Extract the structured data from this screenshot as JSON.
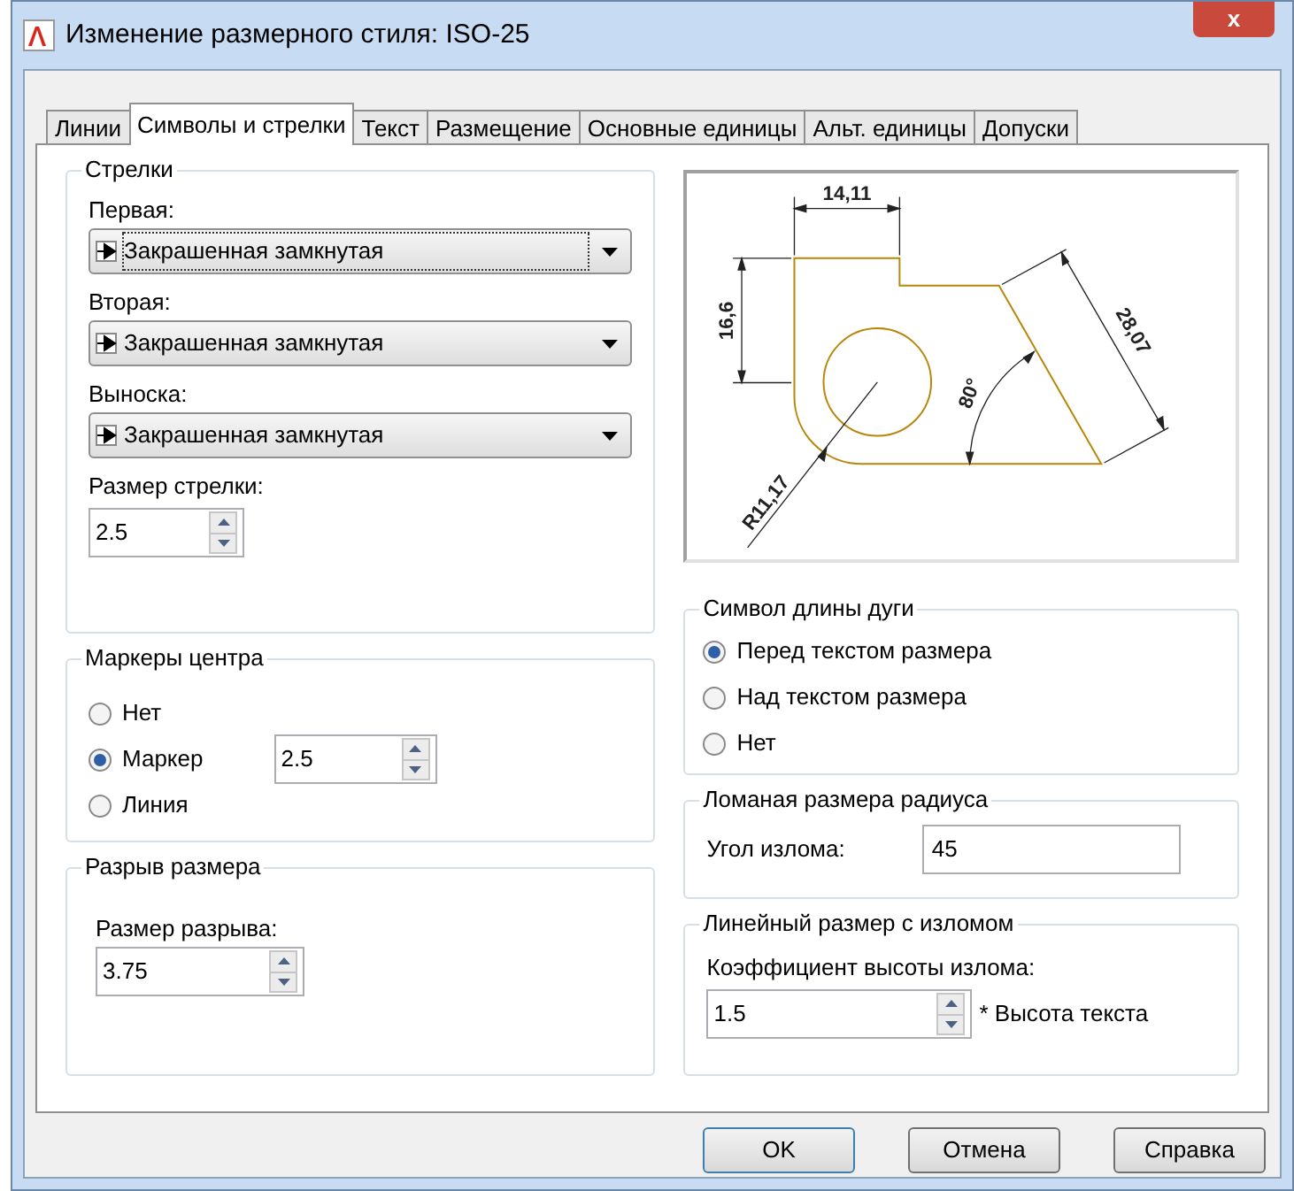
{
  "window": {
    "title": "Изменение размерного стиля: ISO-25",
    "close": "x"
  },
  "tabs": [
    {
      "label": "Линии",
      "selected": false
    },
    {
      "label": "Символы и стрелки",
      "selected": true
    },
    {
      "label": "Текст",
      "selected": false
    },
    {
      "label": "Размещение",
      "selected": false
    },
    {
      "label": "Основные единицы",
      "selected": false
    },
    {
      "label": "Альт. единицы",
      "selected": false
    },
    {
      "label": "Допуски",
      "selected": false
    }
  ],
  "arrows": {
    "title": "Стрелки",
    "dropdowns": [
      {
        "label": "Первая:",
        "value": "Закрашенная замкнутая",
        "focused": true
      },
      {
        "label": "Вторая:",
        "value": "Закрашенная замкнутая",
        "focused": false
      },
      {
        "label": "Выноска:",
        "value": "Закрашенная замкнутая",
        "focused": false
      }
    ],
    "size": {
      "label": "Размер стрелки:",
      "value": "2.5"
    }
  },
  "center_marks": {
    "title": "Маркеры центра",
    "options": [
      {
        "label": "Нет",
        "selected": false
      },
      {
        "label": "Маркер",
        "selected": true
      },
      {
        "label": "Линия",
        "selected": false
      }
    ],
    "size": "2.5"
  },
  "dim_break": {
    "title": "Разрыв размера",
    "size": {
      "label": "Размер разрыва:",
      "value": "3.75"
    }
  },
  "preview": {
    "labels": [
      "14,11",
      "16,6",
      "28,07",
      "80°",
      "R11,17"
    ]
  },
  "arc_length": {
    "title": "Символ длины дуги",
    "options": [
      {
        "label": "Перед текстом размера",
        "selected": true
      },
      {
        "label": "Над текстом размера",
        "selected": false
      },
      {
        "label": "Нет",
        "selected": false
      }
    ]
  },
  "radius_jog": {
    "title": "Ломаная размера радиуса",
    "label": "Угол излома:",
    "value": "45"
  },
  "linear_jog": {
    "title": "Линейный размер с изломом",
    "label": "Коэффициент высоты излома:",
    "value": "1.5",
    "suffix": "* Высота текста"
  },
  "buttons": [
    "OK",
    "Отмена",
    "Справка"
  ]
}
